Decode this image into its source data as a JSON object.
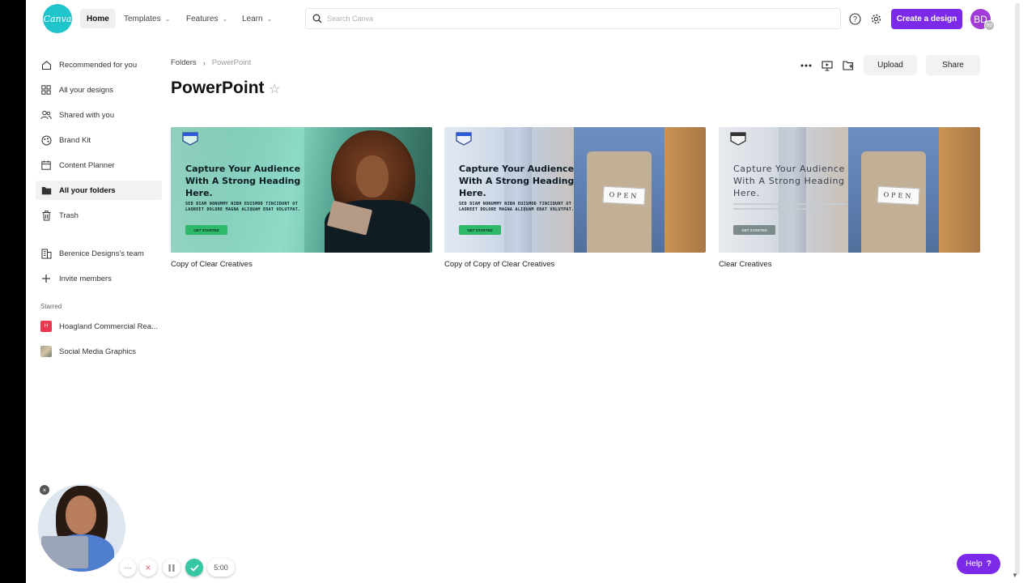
{
  "brand": {
    "logo_text": "Canva",
    "accent": "#7d2ae8",
    "logo_color": "#20c4cb"
  },
  "topnav": {
    "home": "Home",
    "templates": "Templates",
    "features": "Features",
    "learn": "Learn",
    "search_placeholder": "Search Canva",
    "create_label": "Create a design",
    "avatar_initials": "BD",
    "avatar_mini": "BD"
  },
  "sidebar": {
    "items": [
      {
        "label": "Recommended for you",
        "icon": "home-icon"
      },
      {
        "label": "All your designs",
        "icon": "grid-icon"
      },
      {
        "label": "Shared with you",
        "icon": "people-icon"
      },
      {
        "label": "Brand Kit",
        "icon": "brand-icon"
      },
      {
        "label": "Content Planner",
        "icon": "calendar-icon"
      },
      {
        "label": "All your folders",
        "icon": "folder-icon",
        "active": true
      },
      {
        "label": "Trash",
        "icon": "trash-icon"
      }
    ],
    "team": "Berenice Designs's team",
    "invite": "Invite members",
    "starred_label": "Starred",
    "starred": [
      {
        "label": "Hoagland Commercial Rea...",
        "initial": "H"
      },
      {
        "label": "Social Media Graphics"
      }
    ]
  },
  "breadcrumb": {
    "parent": "Folders",
    "current": "PowerPoint"
  },
  "page": {
    "title": "PowerPoint"
  },
  "actions": {
    "upload": "Upload",
    "share": "Share"
  },
  "designs": [
    {
      "title": "Copy of Clear Creatives",
      "headline": "Capture Your Audience With A Strong Heading Here.",
      "sub": "SED DIAM NONUMMY NIBH EUISMOD TINCIDUNT UT LAOREET DOLORE MAGNA ALIQUAM ERAT VOLUTPAT.",
      "cta": "GET STARTED"
    },
    {
      "title": "Copy of Copy of Clear Creatives",
      "headline": "Capture Your Audience With A Strong Heading Here.",
      "sub": "SED DIAM NONUMMY NIBH EUISMOD TINCIDUNT UT LAOREET DOLORE MAGNA ALIQUAM ERAT VOLUTPAT.",
      "cta": "GET STARTED",
      "sign": "OPEN"
    },
    {
      "title": "Clear Creatives",
      "headline": "Capture Your Audience With A Strong Heading Here.",
      "cta": "GET STARTED",
      "sign": "OPEN"
    }
  ],
  "recorder": {
    "timer": "5:00",
    "more": "···"
  },
  "help": {
    "label": "Help",
    "glyph": "?"
  }
}
